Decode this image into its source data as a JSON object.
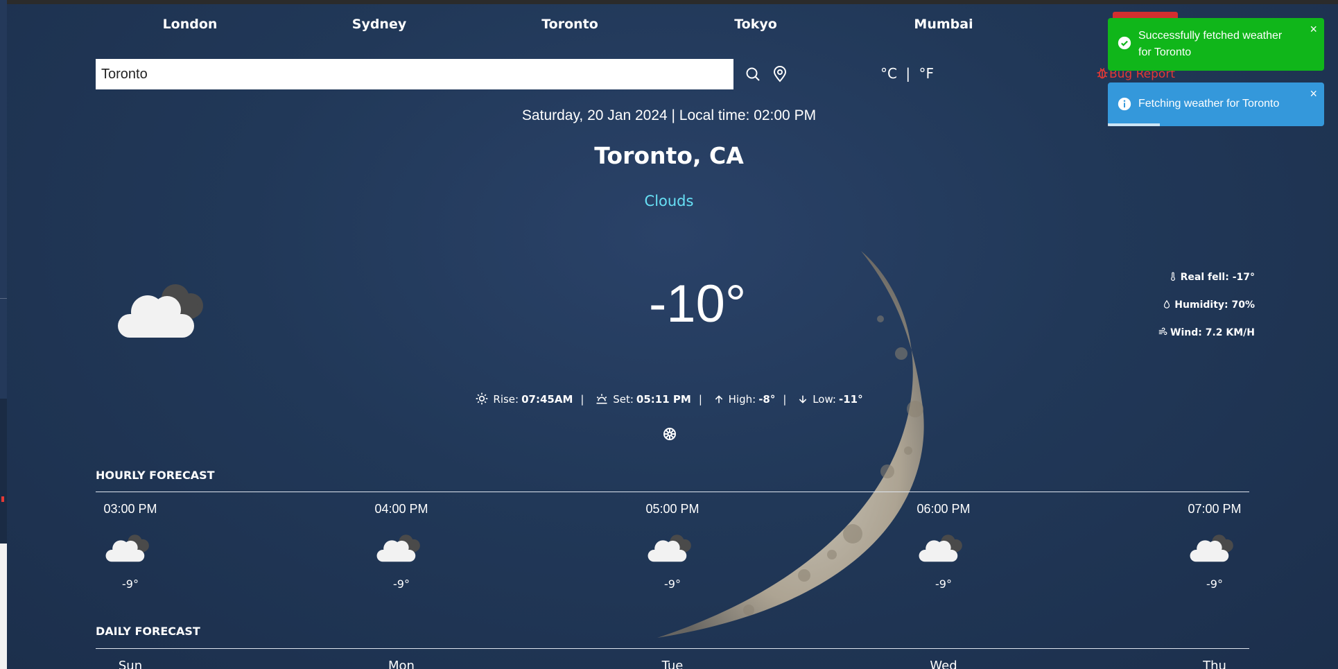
{
  "cities": [
    "London",
    "Sydney",
    "Toronto",
    "Tokyo",
    "Mumbai"
  ],
  "search": {
    "value": "Toronto"
  },
  "units": {
    "celsius": "°C",
    "separator": "|",
    "fahrenheit": "°F"
  },
  "bug_report": "Bug Report",
  "datetime": "Saturday, 20 Jan 2024 | Local time: 02:00 PM",
  "location": "Toronto, CA",
  "condition": "Clouds",
  "temperature": "-10°",
  "details": {
    "real_feel_label": "Real fell:",
    "real_feel": "-17°",
    "humidity_label": "Humidity:",
    "humidity": "70%",
    "wind_label": "Wind:",
    "wind": "7.2 KM/H"
  },
  "sun": {
    "rise_label": "Rise:",
    "rise": "07:45AM",
    "set_label": "Set:",
    "set": "05:11 PM",
    "high_label": "High:",
    "high": "-8°",
    "low_label": "Low:",
    "low": "-11°",
    "separator": "|"
  },
  "hourly": {
    "title": "HOURLY FORECAST",
    "items": [
      {
        "time": "03:00 PM",
        "temp": "-9°",
        "icon": "cloud-icon"
      },
      {
        "time": "04:00 PM",
        "temp": "-9°",
        "icon": "cloud-icon"
      },
      {
        "time": "05:00 PM",
        "temp": "-9°",
        "icon": "cloud-icon"
      },
      {
        "time": "06:00 PM",
        "temp": "-9°",
        "icon": "cloud-icon"
      },
      {
        "time": "07:00 PM",
        "temp": "-9°",
        "icon": "cloud-icon"
      }
    ]
  },
  "daily": {
    "title": "DAILY FORECAST",
    "days": [
      "Sun",
      "Mon",
      "Tue",
      "Wed",
      "Thu"
    ]
  },
  "toasts": {
    "success": "Successfully fetched weather for Toronto",
    "info": "Fetching weather for Toronto",
    "close": "×",
    "info_progress": 0.24
  },
  "colors": {
    "condition": "#67e0f5",
    "bug": "#e53935",
    "toast_success": "#10b61a",
    "toast_info": "#3498db"
  }
}
